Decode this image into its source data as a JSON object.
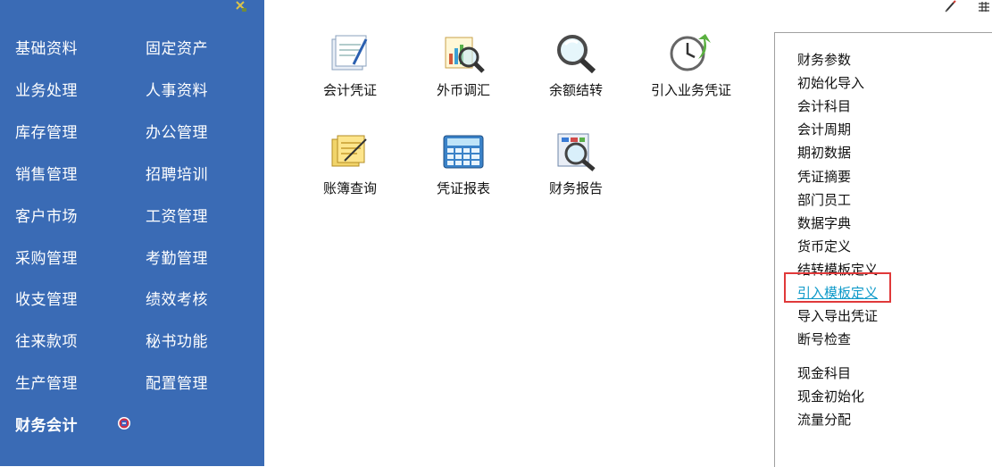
{
  "sidebar": {
    "col1": [
      {
        "label": "基础资料"
      },
      {
        "label": "业务处理"
      },
      {
        "label": "库存管理"
      },
      {
        "label": "销售管理"
      },
      {
        "label": "客户市场"
      },
      {
        "label": "采购管理"
      },
      {
        "label": "收支管理"
      },
      {
        "label": "往来款项"
      },
      {
        "label": "生产管理"
      },
      {
        "label": "财务会计",
        "active": true
      }
    ],
    "col2": [
      {
        "label": "固定资产"
      },
      {
        "label": "人事资料"
      },
      {
        "label": "办公管理"
      },
      {
        "label": "招聘培训"
      },
      {
        "label": "工资管理"
      },
      {
        "label": "考勤管理"
      },
      {
        "label": "绩效考核"
      },
      {
        "label": "秘书功能"
      },
      {
        "label": "配置管理"
      }
    ],
    "background": "#3a6bb5"
  },
  "tiles": [
    {
      "label": "会计凭证",
      "icon": "voucher-icon"
    },
    {
      "label": "外币调汇",
      "icon": "currency-search-icon"
    },
    {
      "label": "余额结转",
      "icon": "magnifier-icon"
    },
    {
      "label": "引入业务凭证",
      "icon": "clock-arrow-icon"
    },
    {
      "label": "账簿查询",
      "icon": "ledger-icon"
    },
    {
      "label": "凭证报表",
      "icon": "calculator-icon"
    },
    {
      "label": "财务报告",
      "icon": "report-search-icon"
    }
  ],
  "right_panel": {
    "links": [
      {
        "label": "财务参数"
      },
      {
        "label": "初始化导入"
      },
      {
        "label": "会计科目"
      },
      {
        "label": "会计周期"
      },
      {
        "label": "期初数据"
      },
      {
        "label": "凭证摘要"
      },
      {
        "label": "部门员工"
      },
      {
        "label": "数据字典"
      },
      {
        "label": "货币定义"
      },
      {
        "label": "结转模板定义"
      },
      {
        "label": "引入模板定义",
        "hover": true
      },
      {
        "label": "导入导出凭证"
      },
      {
        "label": "断号检查"
      }
    ],
    "links2": [
      {
        "label": "现金科目"
      },
      {
        "label": "现金初始化"
      },
      {
        "label": "流量分配"
      }
    ],
    "highlight_color": "#e0393a",
    "hover_color": "#0f9ac9"
  }
}
